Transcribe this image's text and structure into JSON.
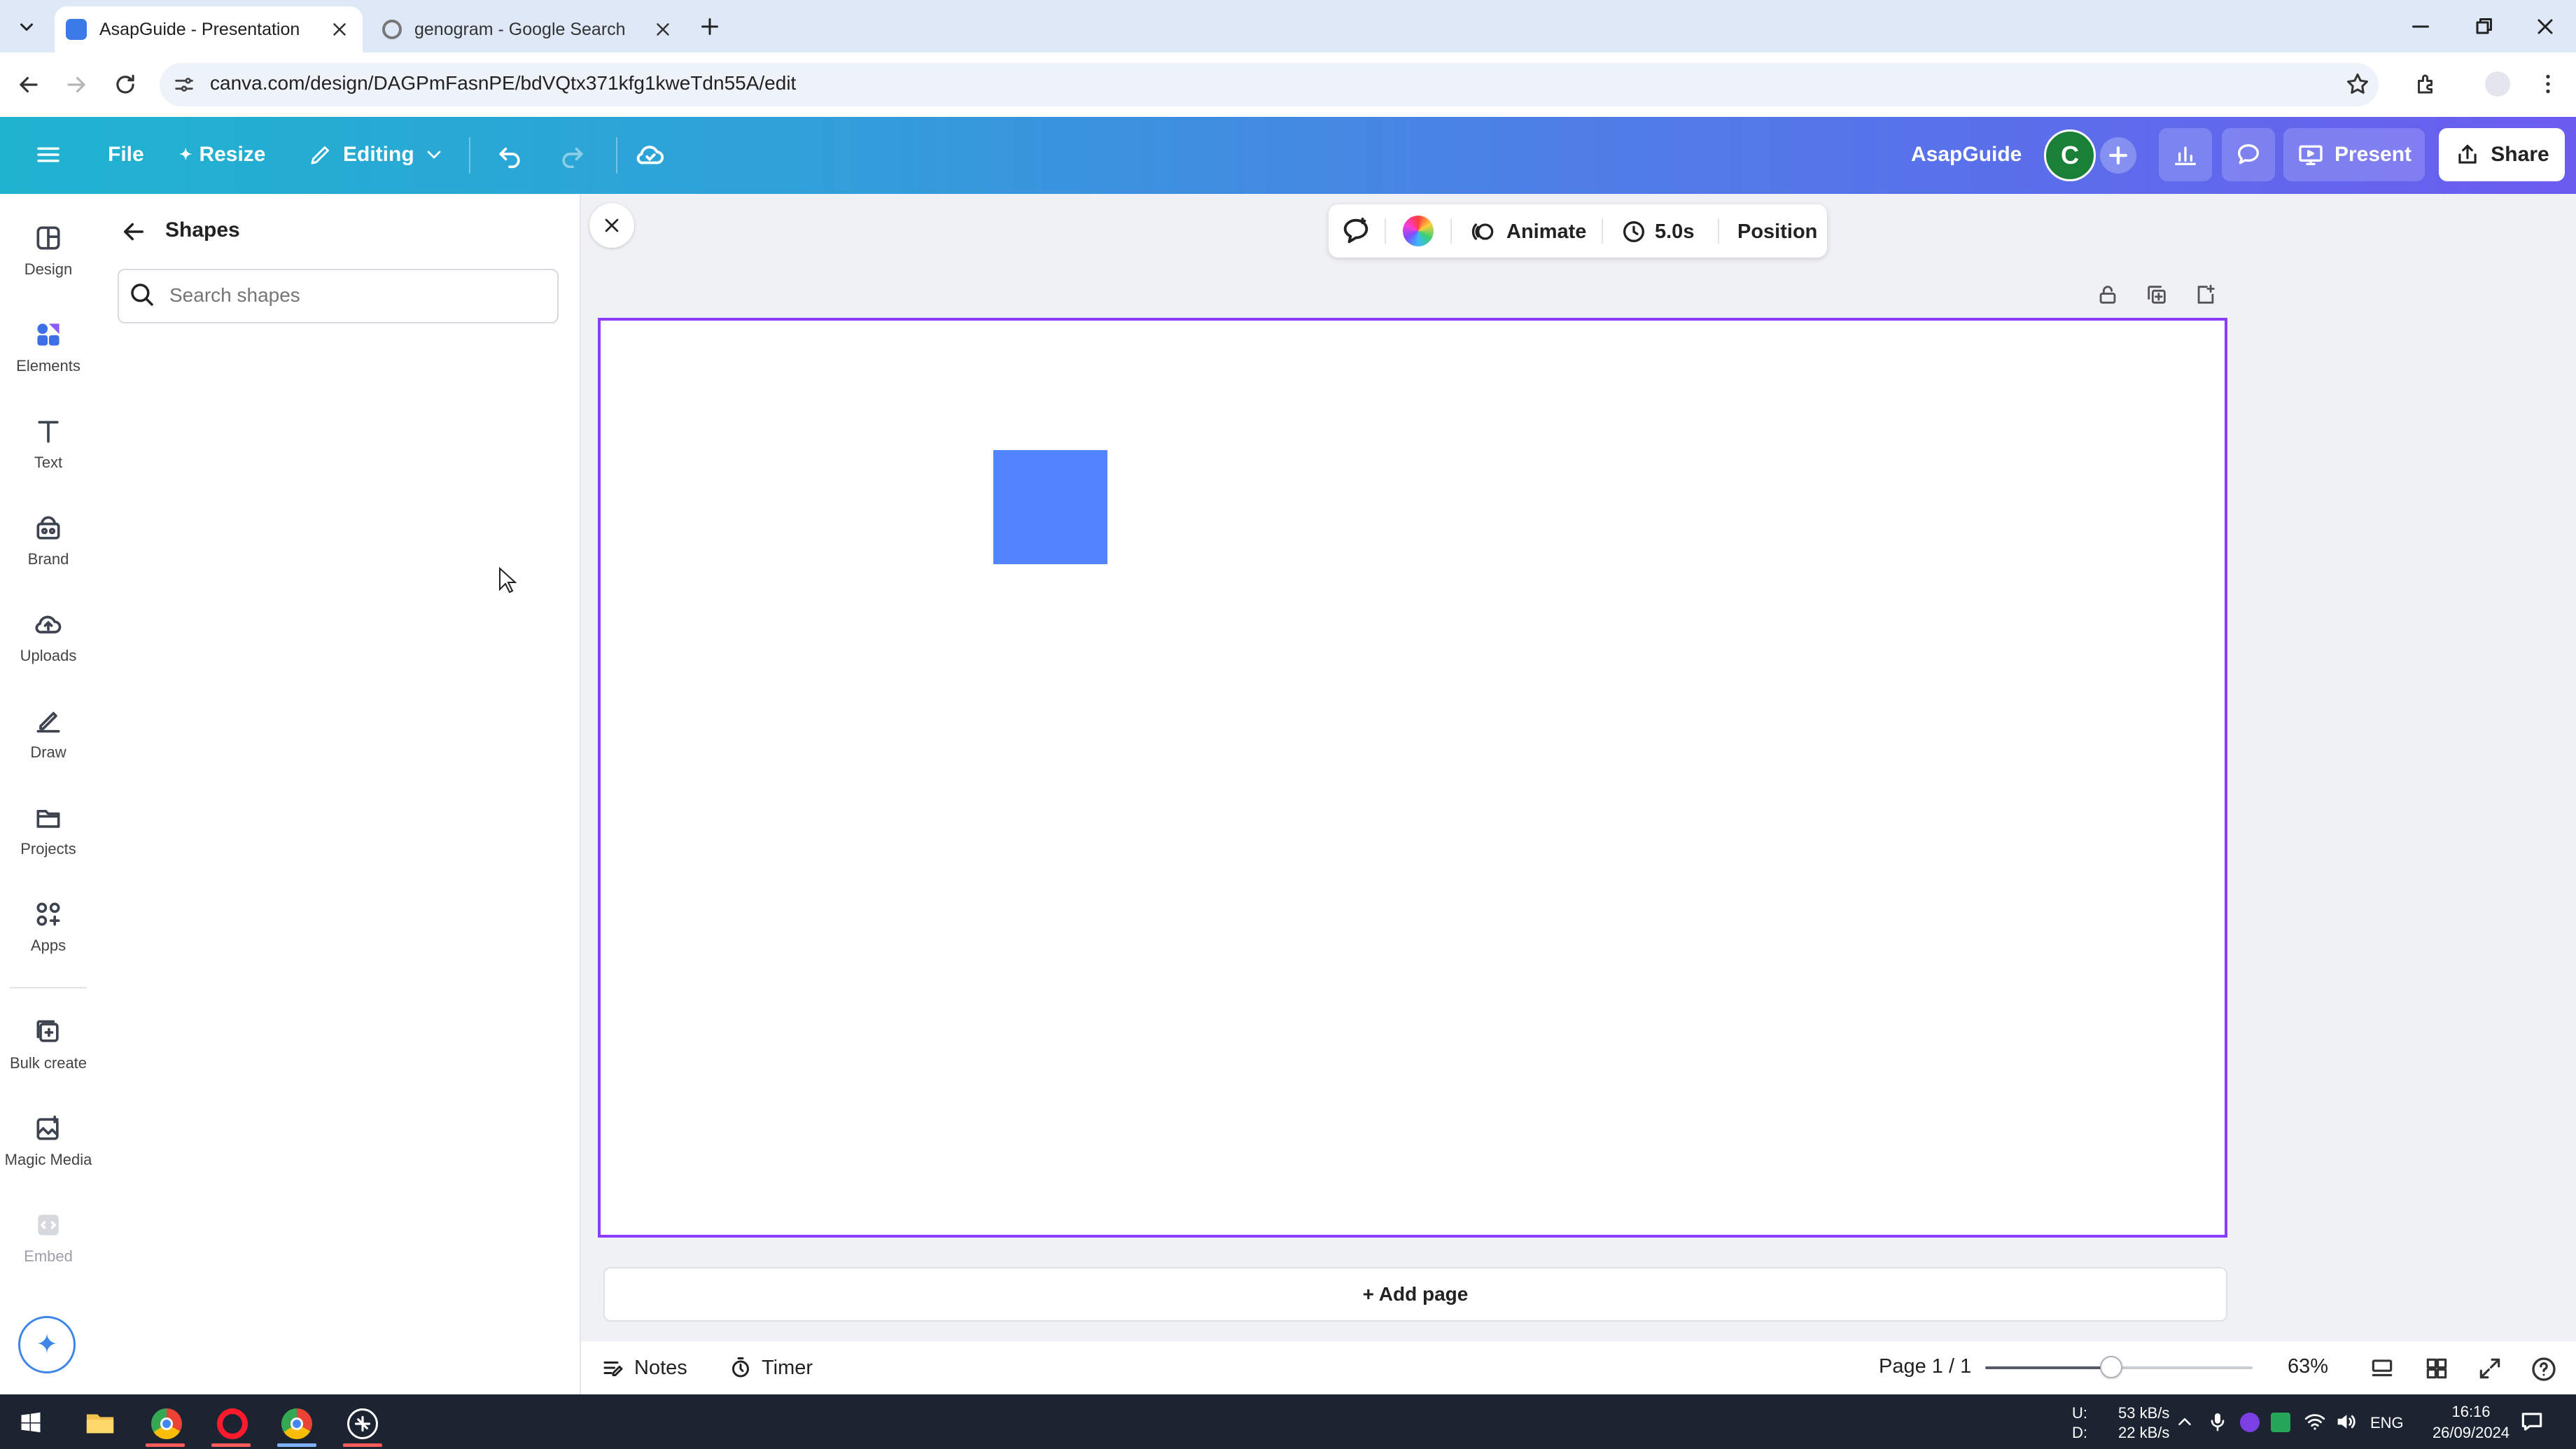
{
  "browser": {
    "tabs": [
      {
        "title": "AsapGuide - Presentation",
        "active": true,
        "icon": "canva-tab-icon"
      },
      {
        "title": "genogram - Google Search",
        "active": false,
        "icon": "google-tab-icon"
      }
    ],
    "url": "canva.com/design/DAGPmFasnPE/bdVQtx371kfg1kweTdn55A/edit"
  },
  "header": {
    "file_label": "File",
    "resize_label": "Resize",
    "editing_label": "Editing",
    "team_name": "AsapGuide",
    "avatar_letter": "C",
    "present_label": "Present",
    "share_label": "Share",
    "gradient_colors": [
      "#1fb3cf",
      "#4d7fe6",
      "#6b5cf0"
    ]
  },
  "sidebar": {
    "items": [
      {
        "label": "Design",
        "icon": "design-icon"
      },
      {
        "label": "Elements",
        "icon": "elements-icon",
        "active": true
      },
      {
        "label": "Text",
        "icon": "text-icon"
      },
      {
        "label": "Brand",
        "icon": "brand-icon"
      },
      {
        "label": "Uploads",
        "icon": "uploads-icon"
      },
      {
        "label": "Draw",
        "icon": "draw-icon"
      },
      {
        "label": "Projects",
        "icon": "projects-icon"
      },
      {
        "label": "Apps",
        "icon": "apps-icon"
      },
      {
        "label": "Bulk create",
        "icon": "bulk-create-icon"
      },
      {
        "label": "Magic Media",
        "icon": "magic-media-icon"
      },
      {
        "label": "Embed",
        "icon": "embed-icon"
      }
    ]
  },
  "panel": {
    "title": "Shapes",
    "search_placeholder": "Search shapes"
  },
  "toolbar": {
    "animate_label": "Animate",
    "duration_label": "5.0s",
    "position_label": "Position"
  },
  "canvas": {
    "shape_color": "#5284ff",
    "border_color": "#8b3dff",
    "add_page_label": "+ Add page"
  },
  "footer": {
    "notes_label": "Notes",
    "timer_label": "Timer",
    "page_label": "Page 1 / 1",
    "zoom_label": "63%",
    "zoom_value_percent": 63
  },
  "taskbar": {
    "net_up_label": "U:",
    "net_down_label": "D:",
    "net_up": "53 kB/s",
    "net_down": "22 kB/s",
    "language": "ENG",
    "time": "16:16",
    "date": "26/09/2024"
  }
}
